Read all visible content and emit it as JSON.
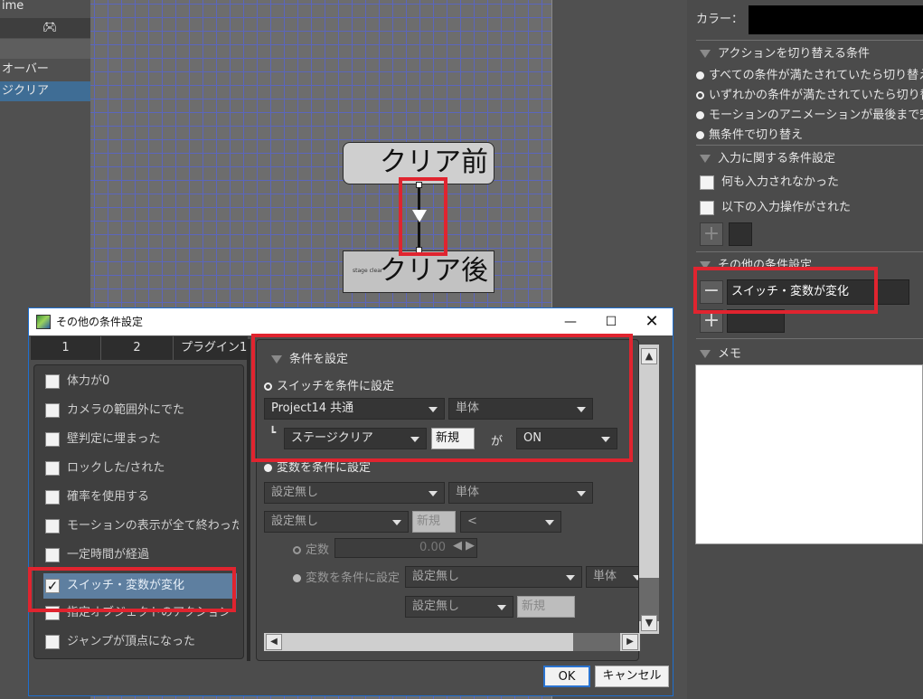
{
  "left_panel": {
    "items": [
      "ime",
      "",
      "",
      "オーバー",
      "ジクリア"
    ]
  },
  "canvas": {
    "node_before": "クリア前",
    "node_after": "クリア後",
    "node_after_small": "stage clear"
  },
  "right_panel": {
    "top_label": "カラー：",
    "sections": {
      "switch_conditions": "アクションを切り替える条件",
      "input_conditions": "入力に関する条件設定",
      "other_conditions": "その他の条件設定",
      "memo": "メモ"
    },
    "radios": [
      "すべての条件が満たされていたら切り替え",
      "いずれかの条件が満たされていたら切り替え",
      "モーションのアニメーションが最後まで完了",
      "無条件で切り替え"
    ],
    "checks": [
      "何も入力されなかった",
      "以下の入力操作がされた"
    ],
    "other_condition_item": "スイッチ・変数が変化",
    "accent_color": "#e0242f"
  },
  "dialog": {
    "title": "その他の条件設定",
    "tabs": [
      "1",
      "2",
      "プラグイン1"
    ],
    "conditions": [
      {
        "label": "体力が0",
        "checked": false
      },
      {
        "label": "カメラの範囲外にでた",
        "checked": false
      },
      {
        "label": "壁判定に埋まった",
        "checked": false
      },
      {
        "label": "ロックした/された",
        "checked": false
      },
      {
        "label": "確率を使用する",
        "checked": false
      },
      {
        "label": "モーションの表示が全て終わった",
        "checked": false
      },
      {
        "label": "一定時間が経過",
        "checked": false
      },
      {
        "label": "スイッチ・変数が変化",
        "checked": true
      },
      {
        "label": "指定オブジェクトのアクション",
        "checked": false
      },
      {
        "label": "ジャンプが頂点になった",
        "checked": false
      }
    ],
    "panel": {
      "header": "条件を設定",
      "switch_radio": "スイッチを条件に設定",
      "switch_scope": "Project14 共通",
      "switch_type": "単体",
      "switch_name": "ステージクリア",
      "new_label": "新規",
      "ga": "が",
      "switch_value": "ON",
      "var_radio": "変数を条件に設定",
      "var_scope": "設定無し",
      "var_type": "単体",
      "var_name": "設定無し",
      "var_new": "新規",
      "var_op": "<",
      "const_label": "定数",
      "const_value": "0.00",
      "var_compare_label": "変数を条件に設定",
      "cmp_scope": "設定無し",
      "cmp_type": "単体",
      "cmp_name": "設定無し",
      "cmp_new": "新規"
    },
    "ok": "OK",
    "cancel": "キャンセル"
  }
}
